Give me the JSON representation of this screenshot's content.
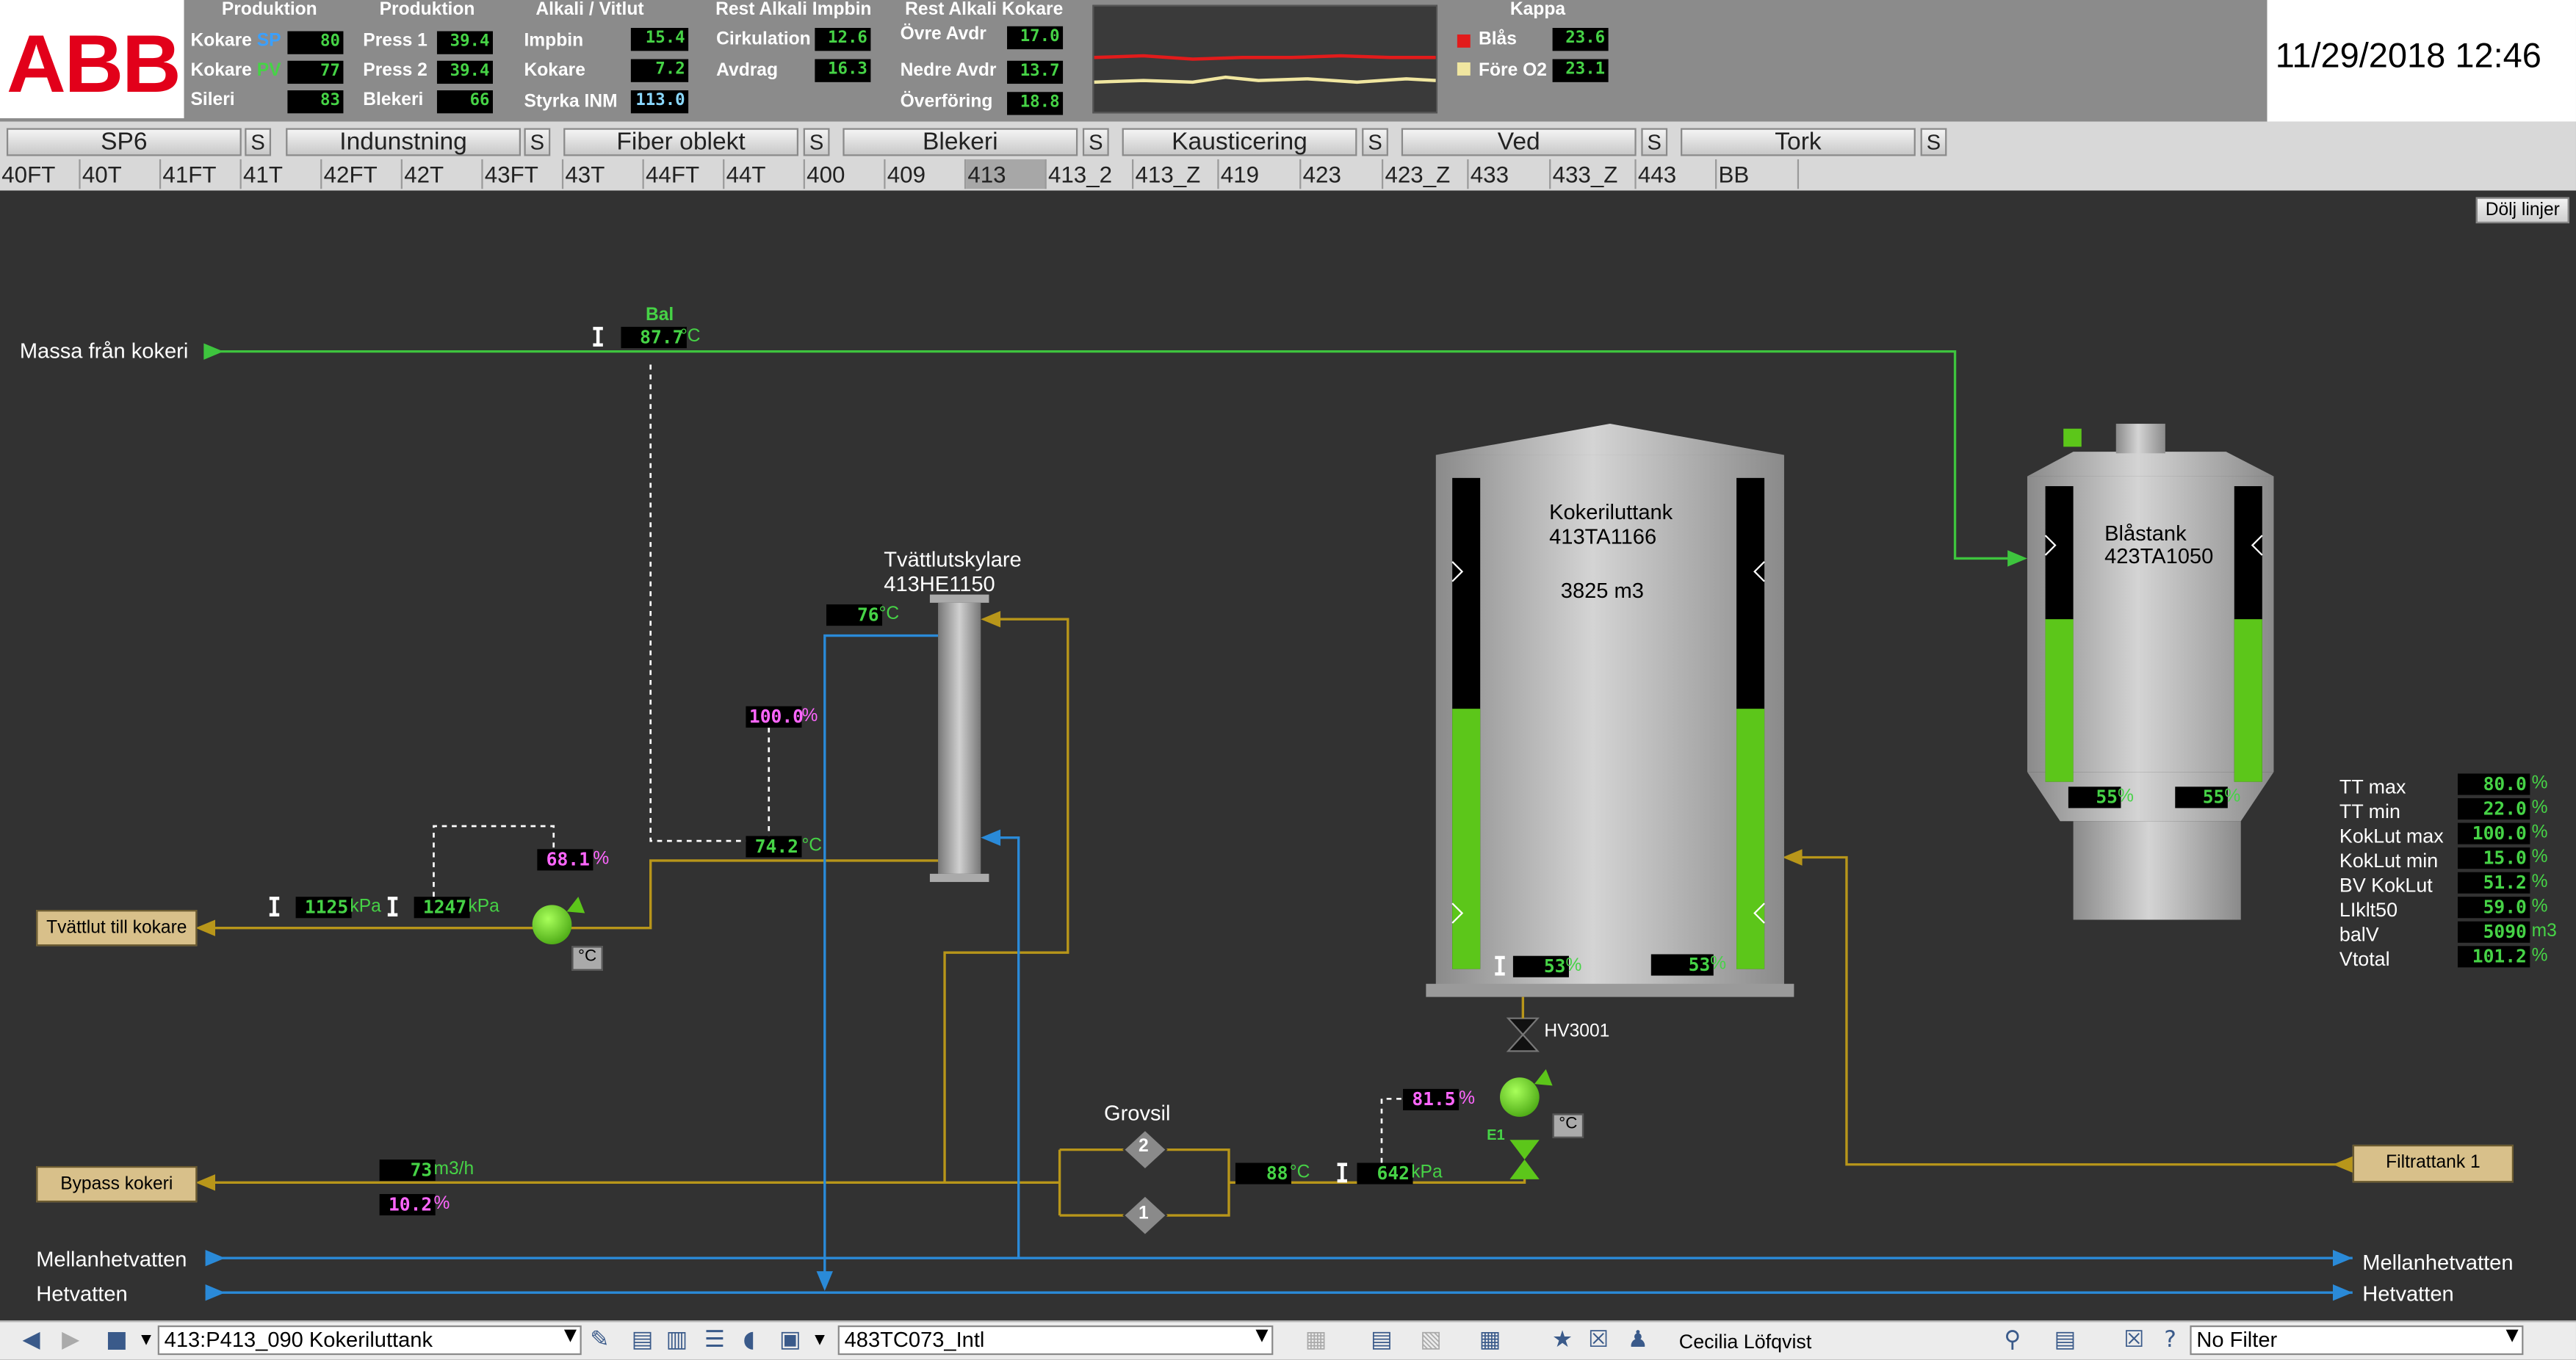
{
  "header": {
    "logo_text": "ABB",
    "groups": [
      {
        "title": "Produktion",
        "rows": [
          {
            "label": "Kokare",
            "tag": "SP",
            "tag_color": "#3aa0ff",
            "value": "80"
          },
          {
            "label": "Kokare",
            "tag": "PV",
            "tag_color": "#46d346",
            "value": "77"
          },
          {
            "label": "Sileri",
            "tag": "",
            "value": "83"
          }
        ]
      },
      {
        "title": "Produktion",
        "rows": [
          {
            "label": "Press 1",
            "value": "39.4"
          },
          {
            "label": "Press 2",
            "value": "39.4"
          },
          {
            "label": "Blekeri",
            "value": "66"
          }
        ]
      },
      {
        "title": "Alkali / Vitlut",
        "rows": [
          {
            "label": "Impbin",
            "value": "15.4"
          },
          {
            "label": "Kokare",
            "value": "7.2"
          },
          {
            "label": "Styrka INM",
            "value": "113.0"
          }
        ]
      },
      {
        "title": "Rest Alkali Impbin",
        "rows": [
          {
            "label": "Cirkulation",
            "value": "12.6"
          },
          {
            "label": "Avdrag",
            "value": "16.3"
          }
        ]
      },
      {
        "title": "Rest Alkali Kokare",
        "rows": [
          {
            "label": "Övre Avdr",
            "value": "17.0"
          },
          {
            "label": "Nedre Avdr",
            "value": "13.7"
          },
          {
            "label": "Överföring",
            "value": "18.8"
          }
        ]
      },
      {
        "title": "Kappa",
        "rows": [
          {
            "label": "Blås",
            "marker_color": "#e21b1b",
            "value": "23.6"
          },
          {
            "label": "Före O2",
            "marker_color": "#f0e6a0",
            "value": "23.1"
          }
        ]
      }
    ],
    "datetime": "11/29/2018 12:46"
  },
  "nav": {
    "areas": [
      {
        "label": "SP6",
        "s": "S"
      },
      {
        "label": "Indunstning",
        "s": "S"
      },
      {
        "label": "Fiber oblekt",
        "s": "S"
      },
      {
        "label": "Blekeri",
        "s": "S"
      },
      {
        "label": "Kausticering",
        "s": "S"
      },
      {
        "label": "Ved",
        "s": "S"
      },
      {
        "label": "Tork",
        "s": "S"
      }
    ],
    "tabs": [
      "40FT",
      "40T",
      "41FT",
      "41T",
      "42FT",
      "42T",
      "43FT",
      "43T",
      "44FT",
      "44T",
      "400",
      "409",
      "413",
      "413_2",
      "413_Z",
      "419",
      "423",
      "423_Z",
      "433",
      "433_Z",
      "443",
      "BB"
    ],
    "selected_tab": "413"
  },
  "diagram": {
    "hide_lines_label": "Dölj linjer",
    "massa_label": "Massa från kokeri",
    "bal_label": "Bal",
    "bal_temp": "87.7",
    "unit_c": "°C",
    "unit_kpa": "kPa",
    "unit_pct": "%",
    "unit_flow": "m3/h",
    "tvattlut_label": "Tvättlut till kokare",
    "bypass_label": "Bypass kokeri",
    "mellanhet_left": "Mellanhetvatten",
    "hetvatten_left": "Hetvatten",
    "mellanhet_right": "Mellanhetvatten",
    "hetvatten_right": "Hetvatten",
    "cooler_name": "Tvättlutskylare",
    "cooler_tag": "413HE1150",
    "cooler_temp": "76",
    "valve_pct_1": "100.0",
    "temp_742": "74.2",
    "pump1_pct": "68.1",
    "press_a": "1125",
    "press_b": "1247",
    "c_badge": "°C",
    "flow_bypass": "73",
    "pct_bypass": "10.2",
    "grovsil_label": "Grovsil",
    "grovsil_1": "1",
    "grovsil_2": "2",
    "temp_88": "88",
    "press_642": "642",
    "pump2_pct": "81.5",
    "pump2_tag": "E1",
    "hv_label": "HV3001",
    "filtrattank_label": "Filtrattank 1",
    "tank1": {
      "name": "Kokeriluttank",
      "tag": "413TA1166",
      "volume": "3825 m3",
      "level_left": "53",
      "level_right": "53",
      "level_fraction": 0.53
    },
    "tank2": {
      "name": "Blåstank",
      "tag": "423TA1050",
      "level_left": "55",
      "level_right": "55",
      "level_fraction": 0.55
    },
    "params": [
      {
        "label": "TT max",
        "value": "80.0",
        "unit": "%"
      },
      {
        "label": "TT min",
        "value": "22.0",
        "unit": "%"
      },
      {
        "label": "KokLut max",
        "value": "100.0",
        "unit": "%"
      },
      {
        "label": "KokLut min",
        "value": "15.0",
        "unit": "%"
      },
      {
        "label": "BV KokLut",
        "value": "51.2",
        "unit": "%"
      },
      {
        "label": "LIklt50",
        "value": "59.0",
        "unit": "%"
      },
      {
        "label": "balV",
        "value": "5090",
        "unit": "m3"
      },
      {
        "label": "Vtotal",
        "value": "101.2",
        "unit": "%"
      }
    ]
  },
  "toolbar": {
    "location": "413:P413_090 Kokeriluttank",
    "object": "483TC073_Intl",
    "user": "Cecilia Löfqvist",
    "filter": "No Filter"
  },
  "colors": {
    "pipe_gold": "#b8961a",
    "pipe_green": "#3ec43e",
    "pipe_blue": "#2a8ad8",
    "level_green": "#5cc61a",
    "text_magenta": "#ff66ff"
  }
}
